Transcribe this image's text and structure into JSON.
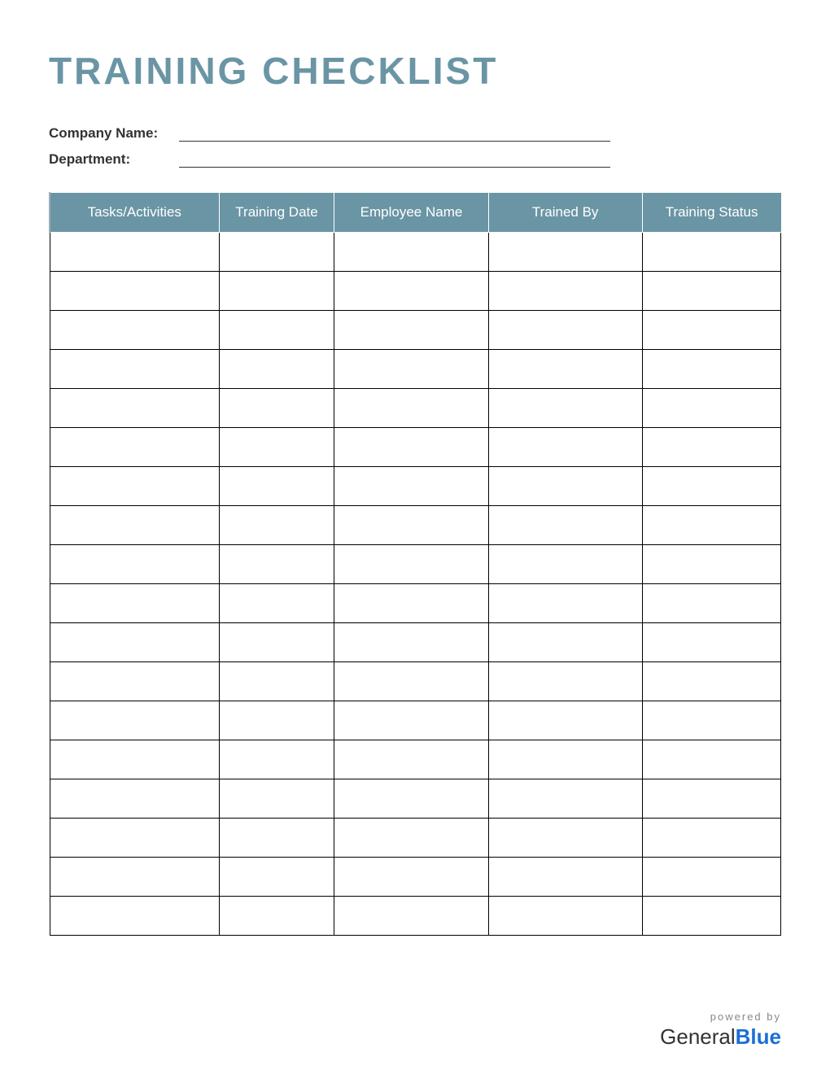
{
  "title": "TRAINING CHECKLIST",
  "info": {
    "company_label": "Company Name:",
    "company_value": "",
    "department_label": "Department:",
    "department_value": ""
  },
  "table": {
    "headers": {
      "tasks": "Tasks/Activities",
      "date": "Training Date",
      "employee": "Employee Name",
      "trained_by": "Trained By",
      "status": "Training Status"
    },
    "rows": [
      {
        "tasks": "",
        "date": "",
        "employee": "",
        "trained_by": "",
        "status": ""
      },
      {
        "tasks": "",
        "date": "",
        "employee": "",
        "trained_by": "",
        "status": ""
      },
      {
        "tasks": "",
        "date": "",
        "employee": "",
        "trained_by": "",
        "status": ""
      },
      {
        "tasks": "",
        "date": "",
        "employee": "",
        "trained_by": "",
        "status": ""
      },
      {
        "tasks": "",
        "date": "",
        "employee": "",
        "trained_by": "",
        "status": ""
      },
      {
        "tasks": "",
        "date": "",
        "employee": "",
        "trained_by": "",
        "status": ""
      },
      {
        "tasks": "",
        "date": "",
        "employee": "",
        "trained_by": "",
        "status": ""
      },
      {
        "tasks": "",
        "date": "",
        "employee": "",
        "trained_by": "",
        "status": ""
      },
      {
        "tasks": "",
        "date": "",
        "employee": "",
        "trained_by": "",
        "status": ""
      },
      {
        "tasks": "",
        "date": "",
        "employee": "",
        "trained_by": "",
        "status": ""
      },
      {
        "tasks": "",
        "date": "",
        "employee": "",
        "trained_by": "",
        "status": ""
      },
      {
        "tasks": "",
        "date": "",
        "employee": "",
        "trained_by": "",
        "status": ""
      },
      {
        "tasks": "",
        "date": "",
        "employee": "",
        "trained_by": "",
        "status": ""
      },
      {
        "tasks": "",
        "date": "",
        "employee": "",
        "trained_by": "",
        "status": ""
      },
      {
        "tasks": "",
        "date": "",
        "employee": "",
        "trained_by": "",
        "status": ""
      },
      {
        "tasks": "",
        "date": "",
        "employee": "",
        "trained_by": "",
        "status": ""
      },
      {
        "tasks": "",
        "date": "",
        "employee": "",
        "trained_by": "",
        "status": ""
      },
      {
        "tasks": "",
        "date": "",
        "employee": "",
        "trained_by": "",
        "status": ""
      }
    ]
  },
  "footer": {
    "powered": "powered by",
    "brand_general": "General",
    "brand_blue": "Blue"
  }
}
